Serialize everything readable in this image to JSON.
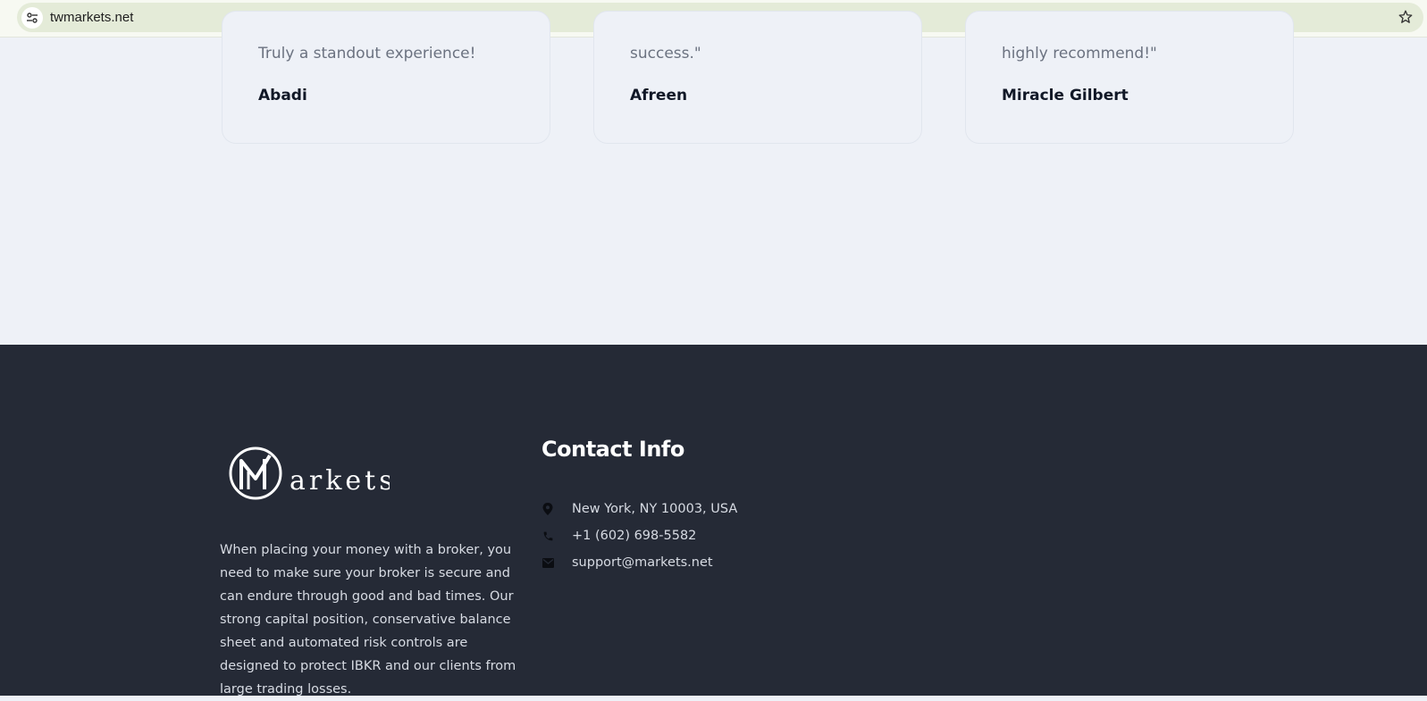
{
  "browser": {
    "url": "twmarkets.net"
  },
  "testimonials": [
    {
      "quote": "Truly a standout experience!",
      "author": "Abadi"
    },
    {
      "quote": "success.\"",
      "author": "Afreen"
    },
    {
      "quote": "highly recommend!\"",
      "author": "Miracle Gilbert"
    }
  ],
  "footer": {
    "about": "When placing your money with a broker, you need to make sure your broker is secure and can endure through good and bad times. Our strong capital position, conservative balance sheet and automated risk controls are designed to protect IBKR and our clients from large trading losses.",
    "contact_title": "Contact Info",
    "contacts": [
      {
        "icon": "location-pin-icon",
        "text": "New York, NY 10003, USA"
      },
      {
        "icon": "phone-icon",
        "text": "+1 (602) 698-5582"
      },
      {
        "icon": "envelope-icon",
        "text": "support@markets.net"
      }
    ]
  },
  "colors": {
    "page_bg": "#eef1f7",
    "footer_bg": "#252a36",
    "card_border": "#e1e6ee"
  }
}
